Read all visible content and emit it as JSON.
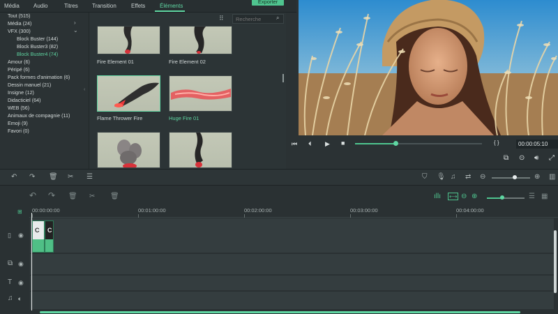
{
  "menu": {
    "tabs": [
      "Média",
      "Audio",
      "Titres",
      "Transition",
      "Effets",
      "Éléments"
    ],
    "active": "Éléments"
  },
  "export_label": "Exporter",
  "categories": [
    {
      "label": "Tout (515)"
    },
    {
      "label": "Média (24)"
    },
    {
      "label": "VFX (300)"
    },
    {
      "label": "Block Buster (144)"
    },
    {
      "label": "Block Buster3 (82)"
    },
    {
      "label": "Block Buster4 (74)"
    },
    {
      "label": "Amour (6)"
    },
    {
      "label": "Péripé (6)"
    },
    {
      "label": "Pack formes d'animation (6)"
    },
    {
      "label": "Dessin manuel (21)"
    },
    {
      "label": "Insigne (12)"
    },
    {
      "label": "Didacticiel (64)"
    },
    {
      "label": "WEB (56)"
    },
    {
      "label": "Animaux de compagnie (11)"
    },
    {
      "label": "Emoji (9)"
    },
    {
      "label": "Favori (0)"
    }
  ],
  "search": {
    "placeholder": "Recherche"
  },
  "elements": [
    {
      "label": "Fire Element 01"
    },
    {
      "label": "Fire Element 02"
    },
    {
      "label": "Flame Thrower Fire"
    },
    {
      "label": "Huge Fire 01"
    }
  ],
  "player": {
    "timecode": "00:00:05:10",
    "progress_fraction": 0.32,
    "braces": "{ }"
  },
  "timeline": {
    "ruler": [
      "00:00:00:00",
      "00:01:00:00",
      "00:02:00:00",
      "00:03:00:00",
      "00:04:00:00"
    ],
    "clip_label": "C"
  },
  "colors": {
    "accent": "#5fd6a2",
    "clip": "#4fbf86"
  }
}
